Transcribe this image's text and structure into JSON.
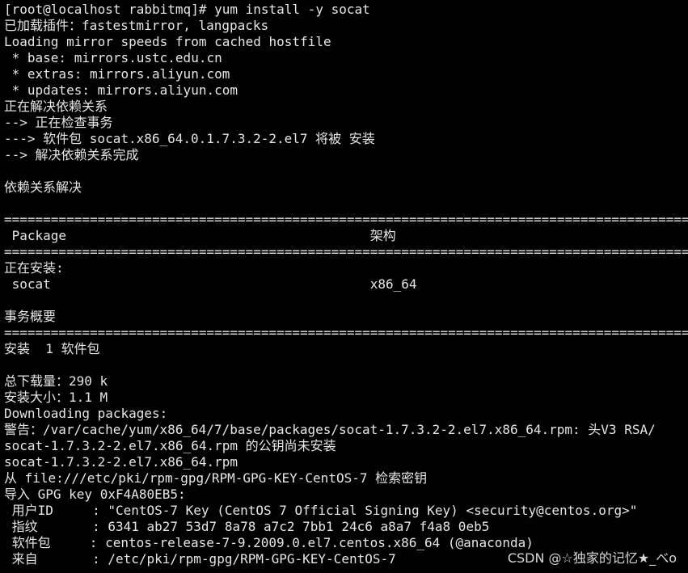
{
  "terminal": {
    "lines": [
      "[root@localhost rabbitmq]# yum install -y socat",
      "已加载插件：fastestmirror, langpacks",
      "Loading mirror speeds from cached hostfile",
      " * base: mirrors.ustc.edu.cn",
      " * extras: mirrors.aliyun.com",
      " * updates: mirrors.aliyun.com",
      "正在解决依赖关系",
      "--> 正在检查事务",
      "---> 软件包 socat.x86_64.0.1.7.3.2-2.el7 将被 安装",
      "--> 解决依赖关系完成",
      "",
      "依赖关系解决",
      "",
      "==================================================================================================",
      " Package                                       架构",
      "==================================================================================================",
      "正在安装:",
      " socat                                         x86_64",
      "",
      "事务概要",
      "==================================================================================================",
      "安装  1 软件包",
      "",
      "总下载量：290 k",
      "安装大小：1.1 M",
      "Downloading packages:",
      "警告：/var/cache/yum/x86_64/7/base/packages/socat-1.7.3.2-2.el7.x86_64.rpm: 头V3 RSA/",
      "socat-1.7.3.2-2.el7.x86_64.rpm 的公钥尚未安装",
      "socat-1.7.3.2-2.el7.x86_64.rpm",
      "从 file:///etc/pki/rpm-gpg/RPM-GPG-KEY-CentOS-7 检索密钥",
      "导入 GPG key 0xF4A80EB5:",
      " 用户ID     : \"CentOS-7 Key (CentOS 7 Official Signing Key) <security@centos.org>\"",
      " 指纹       : 6341 ab27 53d7 8a78 a7c2 7bb1 24c6 a8a7 f4a8 0eb5",
      " 软件包     : centos-release-7-9.2009.0.el7.centos.x86_64 (@anaconda)",
      " 来自       : /etc/pki/rpm-gpg/RPM-GPG-KEY-CentOS-7"
    ]
  },
  "watermark": "CSDN @☆独家的记忆★_べo",
  "colors": {
    "background": "#000000",
    "foreground": "#e6e6e6"
  }
}
